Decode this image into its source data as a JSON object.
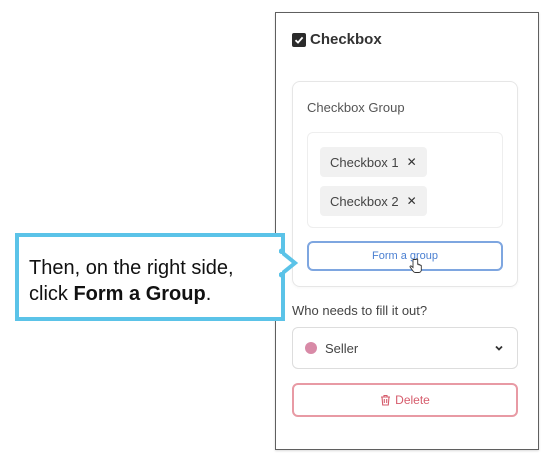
{
  "panel": {
    "title": "Checkbox",
    "group": {
      "title": "Checkbox Group",
      "chips": [
        {
          "label": "Checkbox 1",
          "remove": "✕"
        },
        {
          "label": "Checkbox 2",
          "remove": "✕"
        }
      ],
      "form_group_label": "Form a group"
    },
    "question": "Who needs to fill it out?",
    "select": {
      "value": "Seller",
      "dot_color": "#d88aa7"
    },
    "delete_label": "Delete"
  },
  "callout": {
    "line1": "Then, on the right side,",
    "line2_prefix": "click ",
    "line2_bold": "Form a Group",
    "line2_suffix": "."
  },
  "colors": {
    "callout_border": "#5bc3e8",
    "form_group_border": "#7ea6e0",
    "delete_border": "#e89aa4"
  }
}
